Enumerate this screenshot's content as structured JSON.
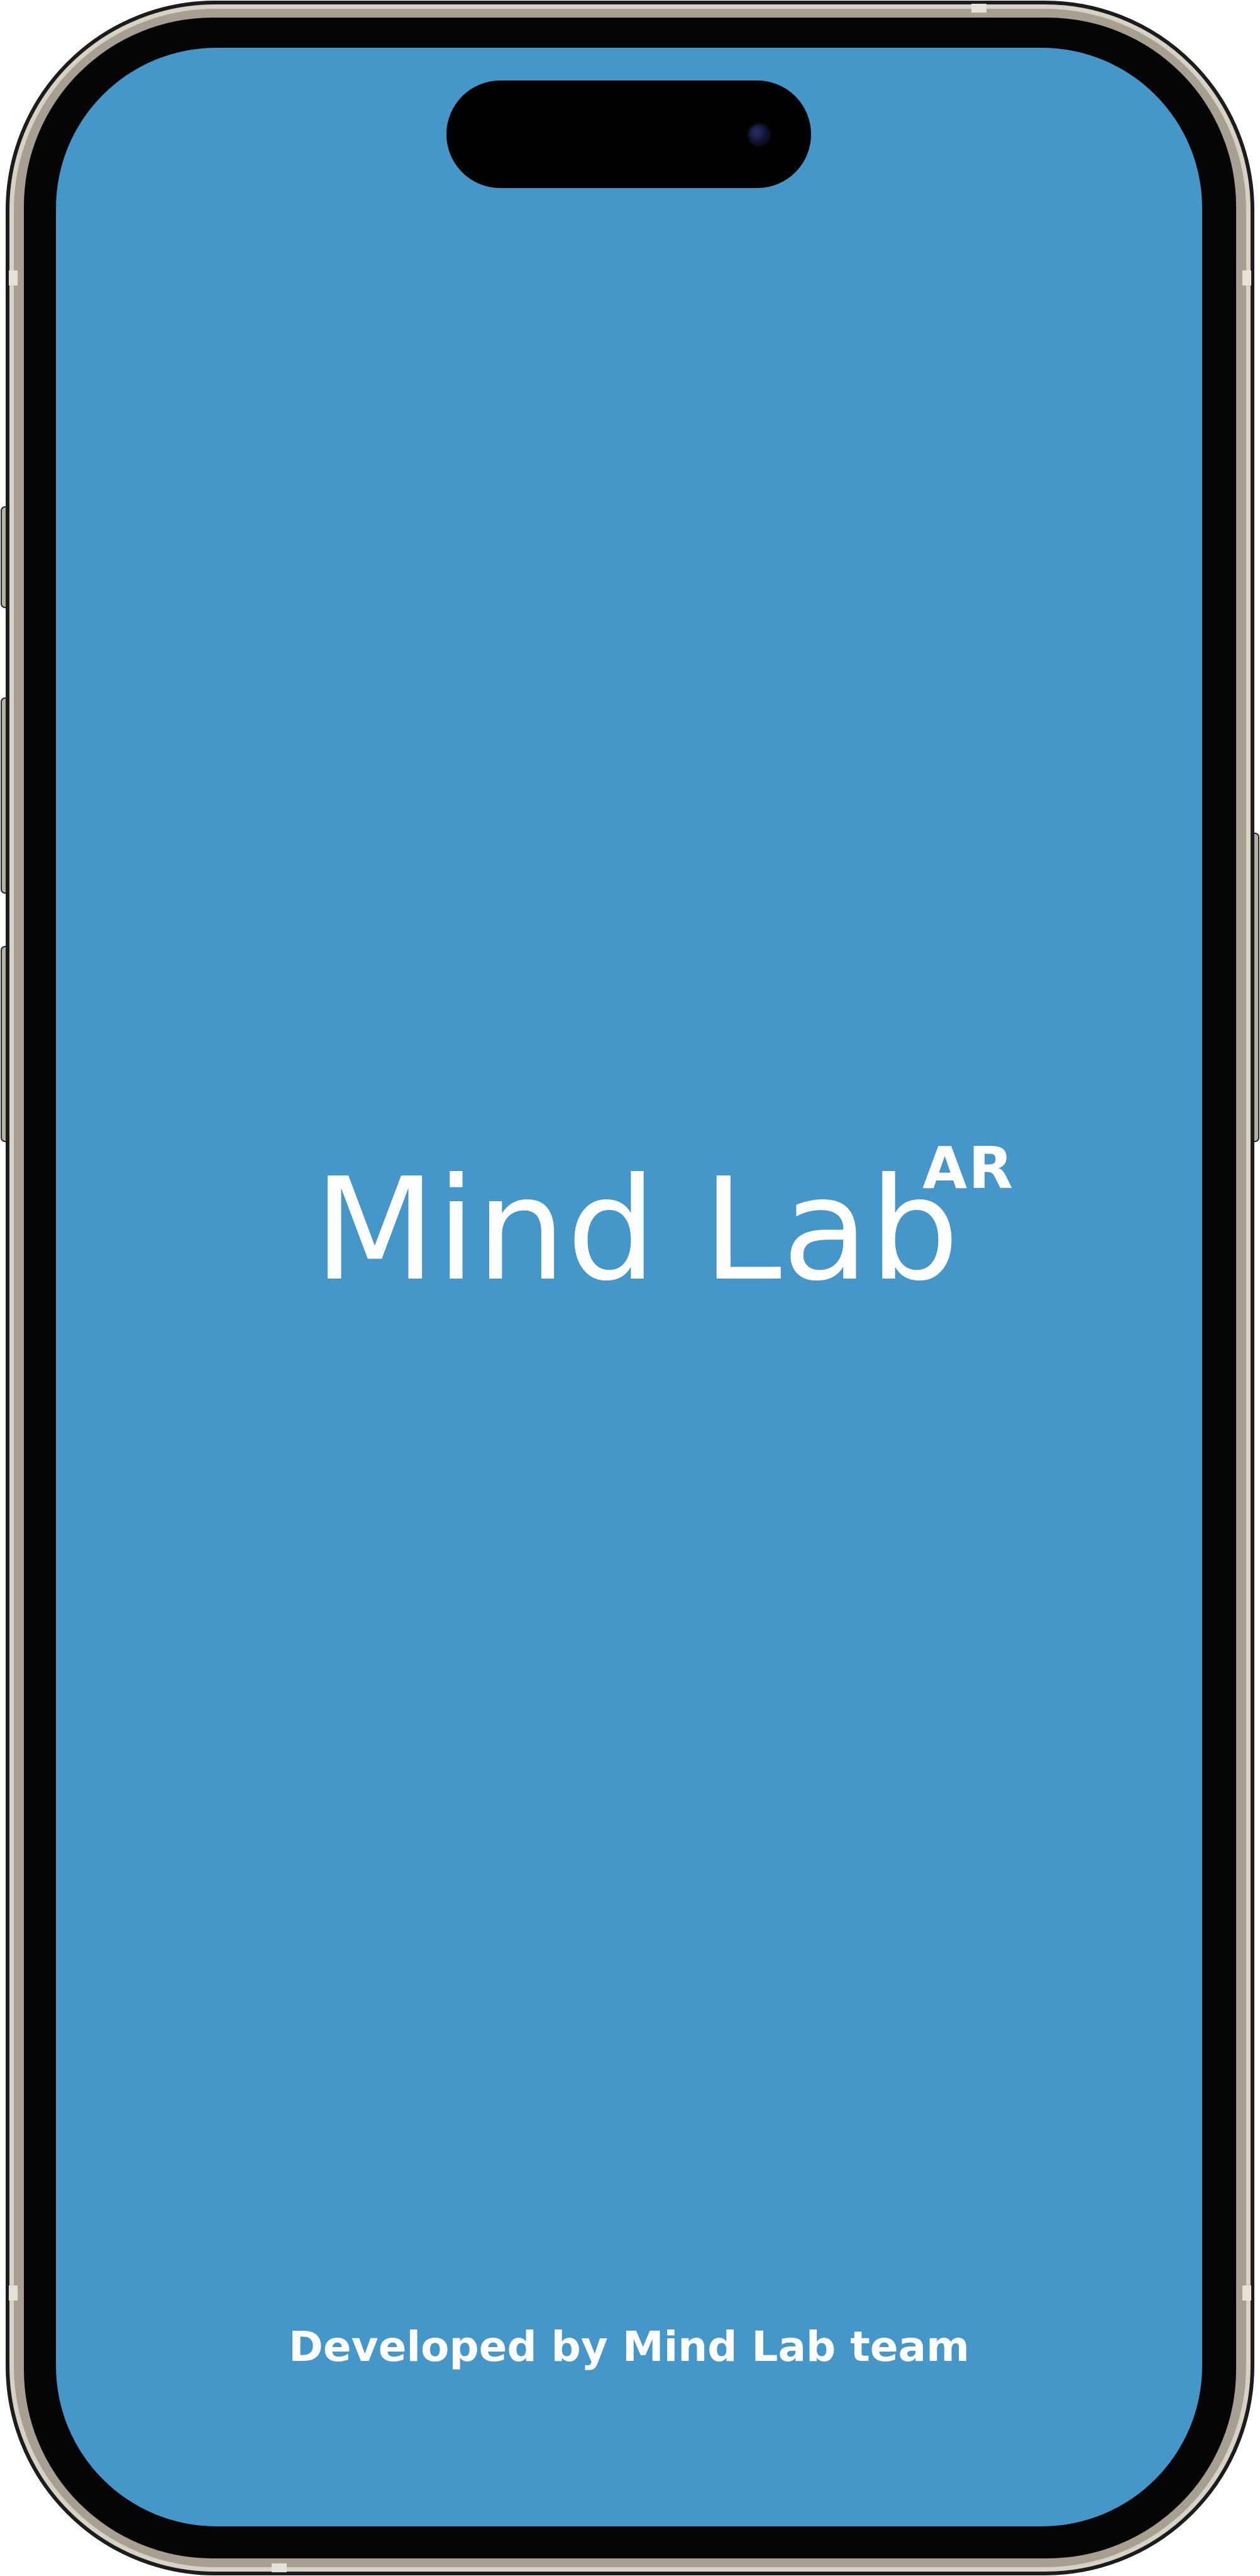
{
  "app": {
    "brand_name": "Mind Lab",
    "brand_suffix": "AR",
    "credit_text": "Developed by Mind Lab team"
  },
  "colors": {
    "screen_background": "#4597c9",
    "text": "#ffffff",
    "bezel": "#000000",
    "frame": "#b9b1a4"
  },
  "icons": {
    "front_camera": "front-camera-icon"
  }
}
